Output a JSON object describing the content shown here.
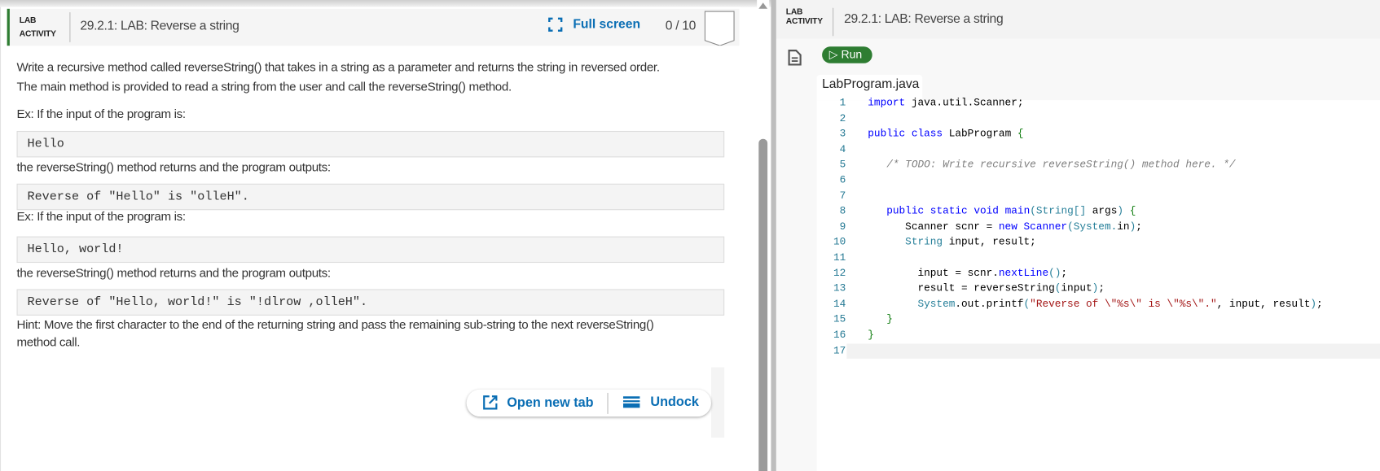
{
  "left": {
    "header": {
      "badge_line1": "LAB",
      "badge_line2": "ACTIVITY",
      "title": "29.2.1: LAB: Reverse a string",
      "fullscreen": "Full screen",
      "score": "0 / 10"
    },
    "desc1": "Write a recursive method called reverseString() that takes in a string as a parameter and returns the string in reversed order.",
    "desc2": "The main method is provided to read a string from the user and call the reverseString() method.",
    "ex1": "Ex: If the input of the program is:",
    "in1": "Hello",
    "out_label1": "the reverseString() method returns and the program outputs:",
    "out1": "Reverse of \"Hello\" is \"olleH\".",
    "ex2": "Ex: If the input of the program is:",
    "in2": "Hello, world!",
    "out_label2": "the reverseString() method returns and the program outputs:",
    "out2": "Reverse of \"Hello, world!\" is \"!dlrow ,olleH\".",
    "hint1": "Hint: Move the first character to the end of the returning string and pass the remaining sub-string to the next reverseString()",
    "hint2": "method call.",
    "open_new_tab": "Open new tab",
    "undock": "Undock"
  },
  "right": {
    "header": {
      "badge_line1": "LAB",
      "badge_line2": "ACTIVITY",
      "title": "29.2.1: LAB: Reverse a string"
    },
    "run": "Run",
    "file_tab": "LabProgram.java",
    "code": [
      [
        [
          "kw",
          "import"
        ],
        [
          "pl",
          " java.util.Scanner;"
        ]
      ],
      [],
      [
        [
          "kw",
          "public"
        ],
        [
          "pl",
          " "
        ],
        [
          "kw",
          "class"
        ],
        [
          "pl",
          " LabProgram "
        ],
        [
          "br",
          "{"
        ]
      ],
      [],
      [
        [
          "pl",
          "   "
        ],
        [
          "cm",
          "/* TODO: Write recursive reverseString() method here. */"
        ]
      ],
      [],
      [],
      [
        [
          "pl",
          "   "
        ],
        [
          "kw",
          "public"
        ],
        [
          "pl",
          " "
        ],
        [
          "kw",
          "static"
        ],
        [
          "pl",
          " "
        ],
        [
          "kw",
          "void"
        ],
        [
          "pl",
          " "
        ],
        [
          "kw",
          "main"
        ],
        [
          "ty",
          "("
        ],
        [
          "ty",
          "String"
        ],
        [
          "ty",
          "[]"
        ],
        [
          "pl",
          " args"
        ],
        [
          "ty",
          ")"
        ],
        [
          "pl",
          " "
        ],
        [
          "br",
          "{"
        ]
      ],
      [
        [
          "pl",
          "      Scanner scnr = "
        ],
        [
          "kw",
          "new"
        ],
        [
          "pl",
          " "
        ],
        [
          "kw",
          "Scanner"
        ],
        [
          "ty",
          "(System."
        ],
        [
          "pl",
          "in"
        ],
        [
          "ty",
          ")"
        ],
        [
          "pl",
          ";"
        ]
      ],
      [
        [
          "pl",
          "      "
        ],
        [
          "ty",
          "String"
        ],
        [
          "pl",
          " input, result;"
        ]
      ],
      [],
      [
        [
          "pl",
          "        input = scnr."
        ],
        [
          "kw",
          "nextLine"
        ],
        [
          "ty",
          "()"
        ],
        [
          "pl",
          ";"
        ]
      ],
      [
        [
          "pl",
          "        result = reverseString"
        ],
        [
          "ty",
          "("
        ],
        [
          "pl",
          "input"
        ],
        [
          "ty",
          ")"
        ],
        [
          "pl",
          ";"
        ]
      ],
      [
        [
          "pl",
          "        "
        ],
        [
          "ty",
          "System"
        ],
        [
          "pl",
          ".out.printf"
        ],
        [
          "ty",
          "("
        ],
        [
          "st",
          "\"Reverse of \\\"%s\\\" is \\\"%s\\\".\""
        ],
        [
          "pl",
          ", input, result"
        ],
        [
          "ty",
          ")"
        ],
        [
          "pl",
          ";"
        ]
      ],
      [
        [
          "pl",
          "   "
        ],
        [
          "br",
          "}"
        ]
      ],
      [
        [
          "br",
          "}"
        ]
      ],
      []
    ]
  },
  "colors": {
    "accent": "#0a6eb4",
    "run": "#2e7d32",
    "activity_bar": "#2e7d32"
  }
}
